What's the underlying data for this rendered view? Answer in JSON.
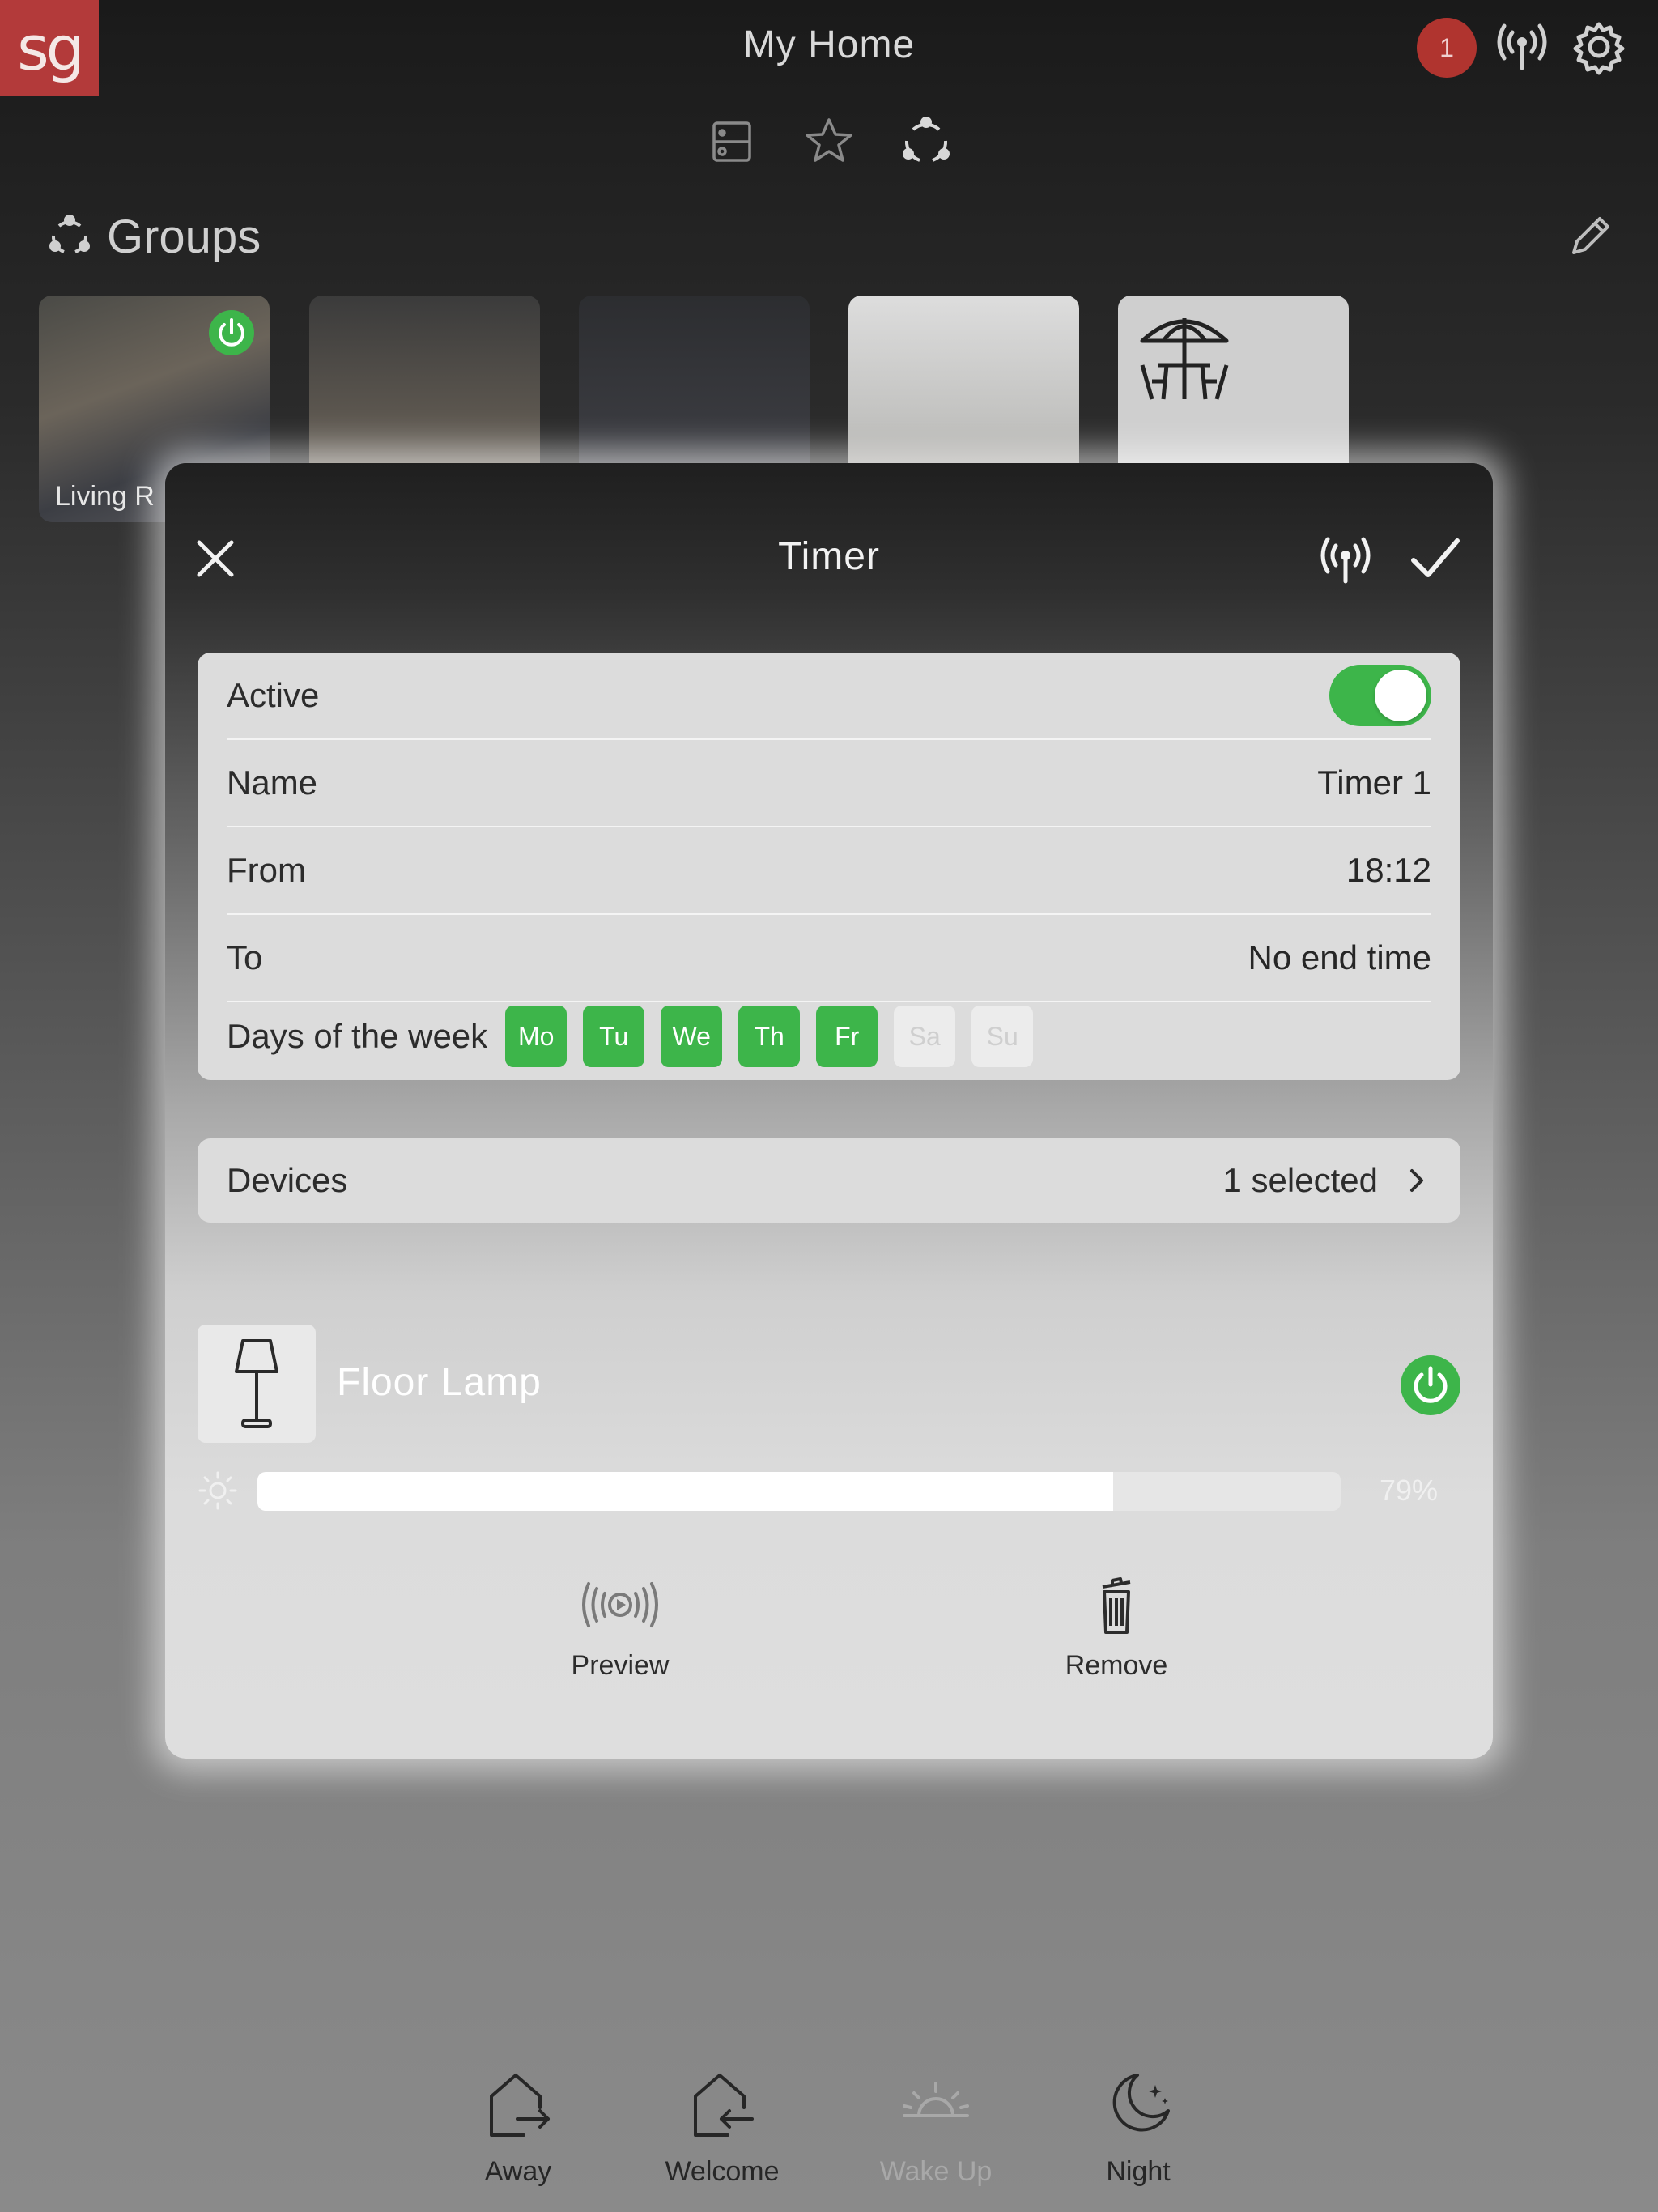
{
  "app": {
    "title": "My Home",
    "logo_text": "sg",
    "notification_count": "1"
  },
  "groups": {
    "title": "Groups",
    "tiles": [
      {
        "label": "Living R",
        "powered": true
      },
      {
        "label": ""
      },
      {
        "label": ""
      },
      {
        "label": ""
      },
      {
        "label": ""
      }
    ]
  },
  "modal": {
    "title": "Timer",
    "rows": {
      "active_label": "Active",
      "active_on": true,
      "name_label": "Name",
      "name_value": "Timer 1",
      "from_label": "From",
      "from_value": "18:12",
      "to_label": "To",
      "to_value": "No end time",
      "days_label": "Days of the week"
    },
    "days": [
      {
        "label": "Mo",
        "on": true
      },
      {
        "label": "Tu",
        "on": true
      },
      {
        "label": "We",
        "on": true
      },
      {
        "label": "Th",
        "on": true
      },
      {
        "label": "Fr",
        "on": true
      },
      {
        "label": "Sa",
        "on": false
      },
      {
        "label": "Su",
        "on": false
      }
    ],
    "devices": {
      "label": "Devices",
      "value": "1 selected"
    },
    "device": {
      "name": "Floor Lamp",
      "brightness": 79,
      "brightness_label": "79%"
    },
    "actions": {
      "preview": "Preview",
      "remove": "Remove"
    }
  },
  "scenes": [
    {
      "label": "Away"
    },
    {
      "label": "Welcome"
    },
    {
      "label": "Wake Up"
    },
    {
      "label": "Night"
    }
  ],
  "colors": {
    "accent_green": "#3db54a",
    "logo_red": "#b33a3a",
    "badge_red": "#b0342f"
  }
}
